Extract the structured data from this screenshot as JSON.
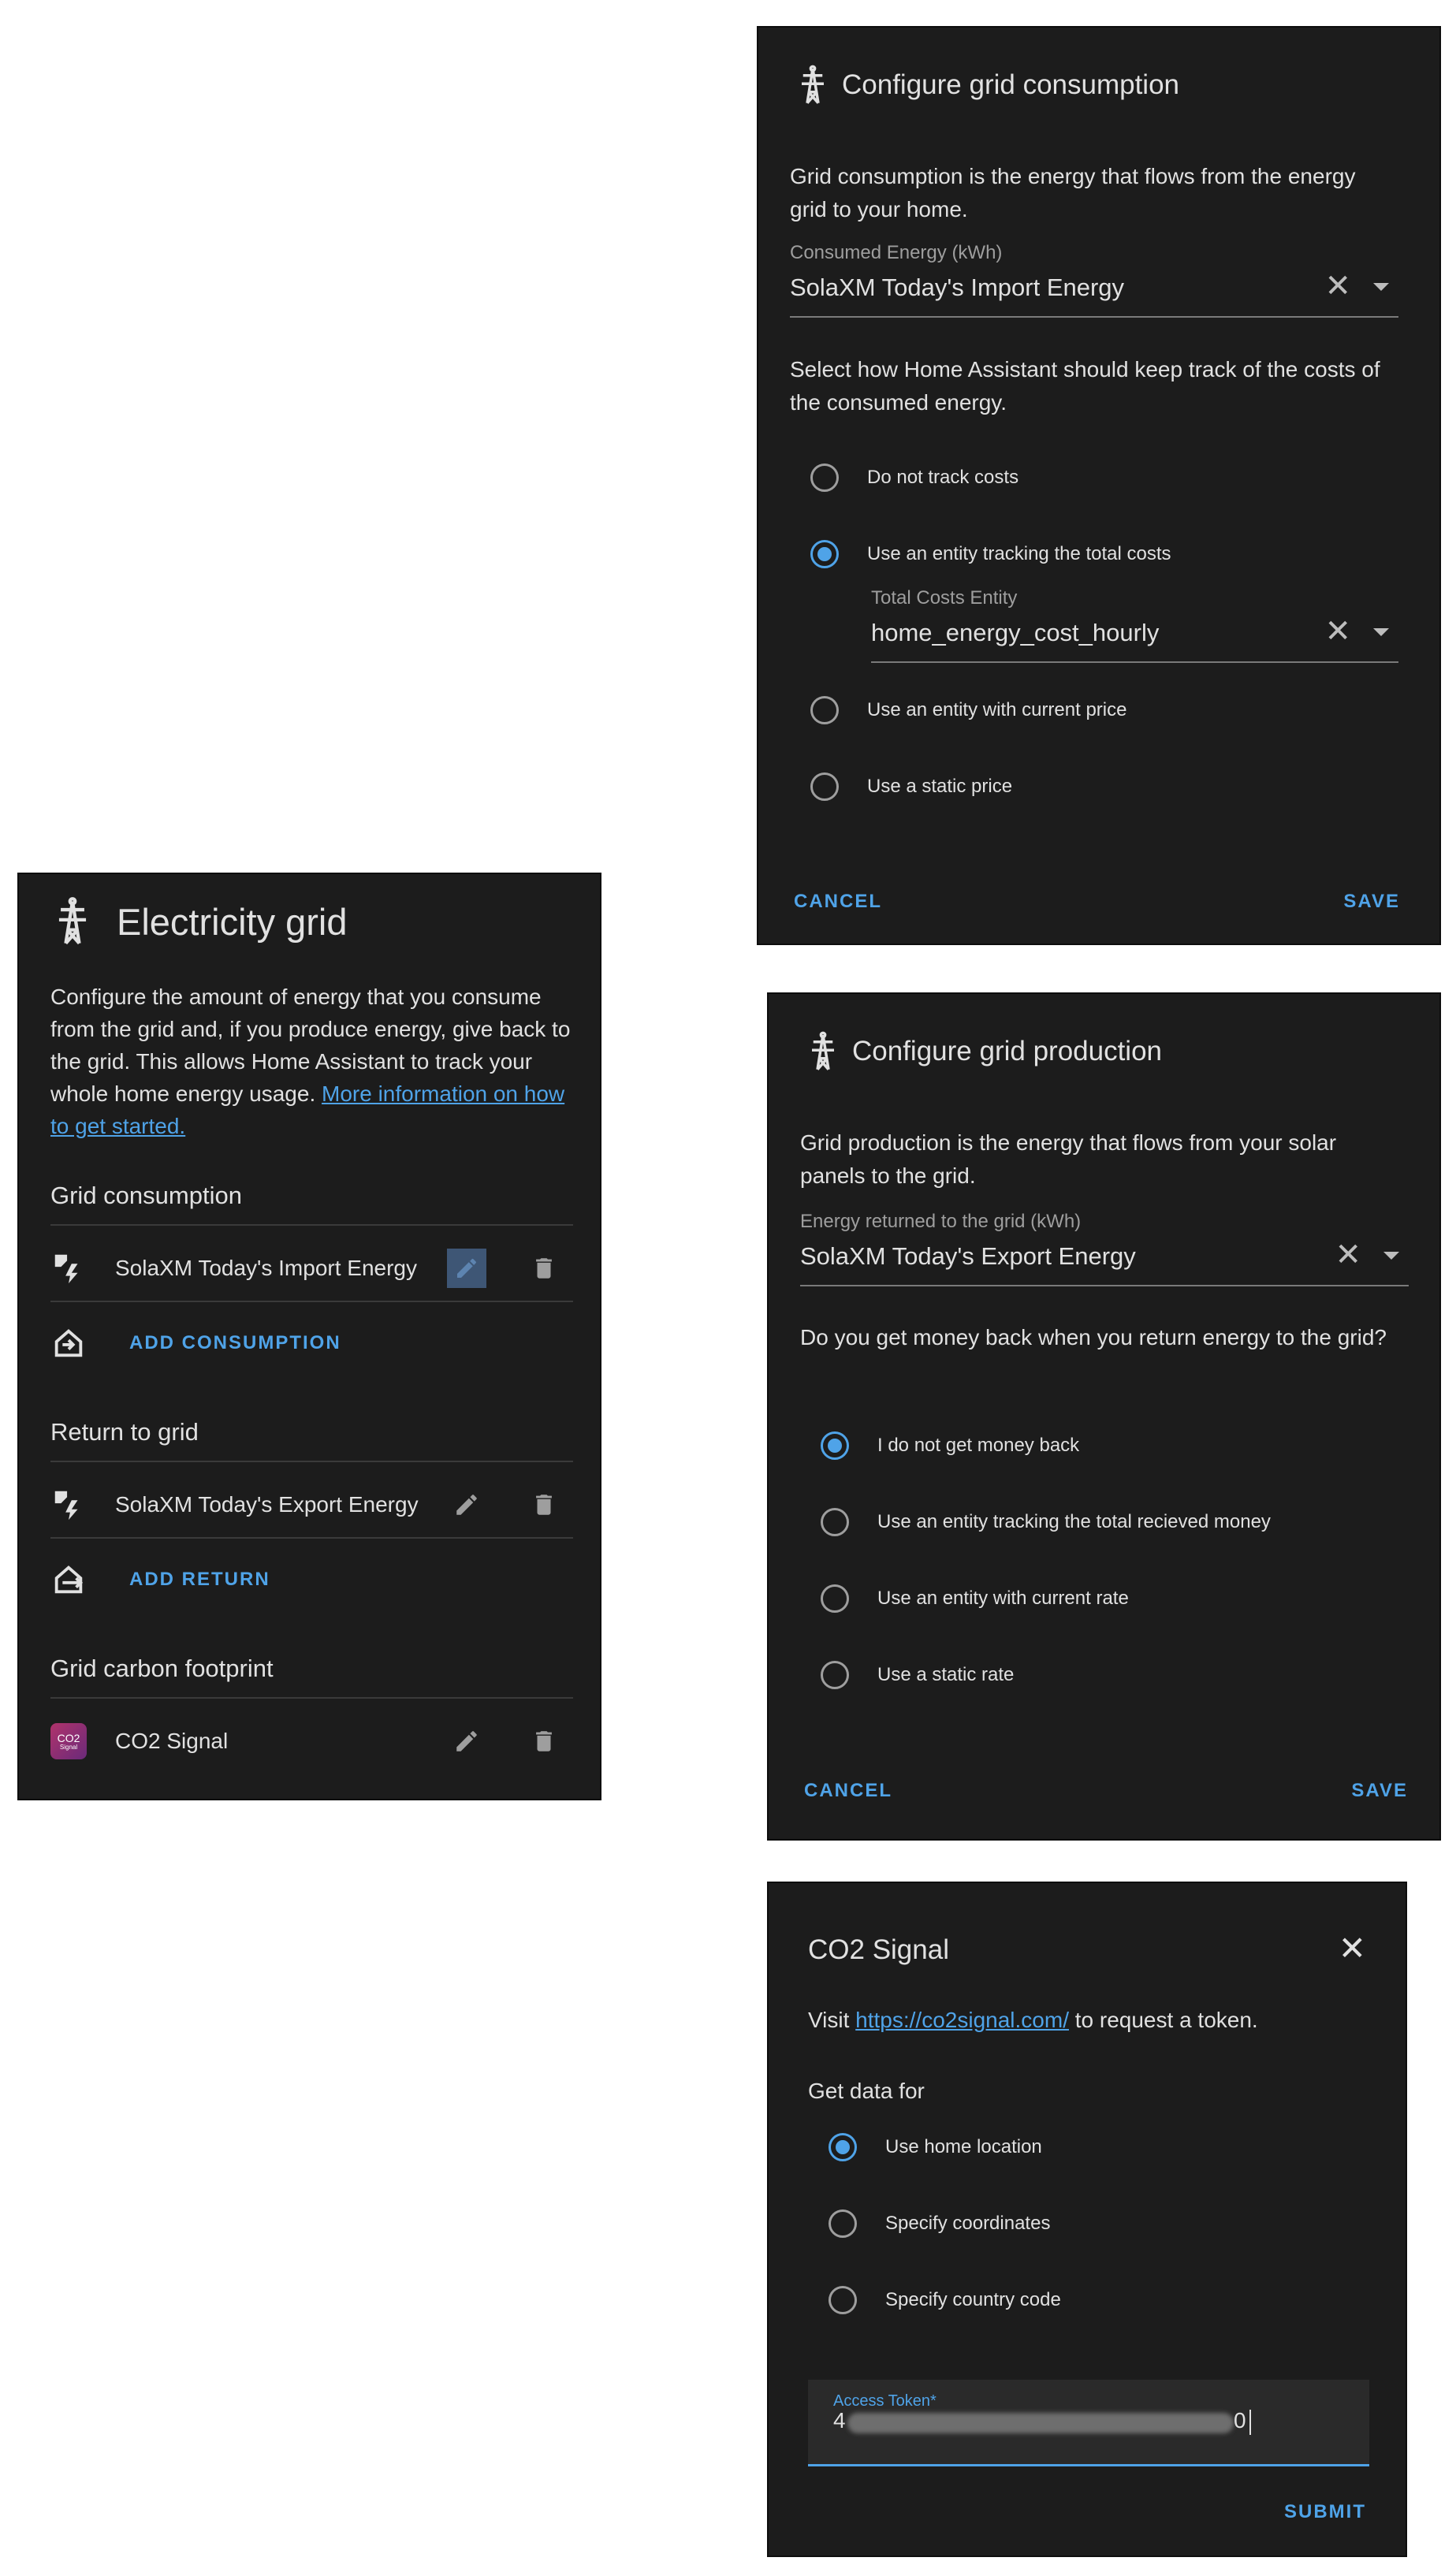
{
  "grid_panel": {
    "title": "Electricity grid",
    "description": "Configure the amount of energy that you consume from the grid and, if you produce energy, give back to the grid. This allows Home Assistant to track your whole home energy usage.",
    "more_info_link": "More information on how to get started.",
    "consumption": {
      "header": "Grid consumption",
      "entity": "SolaXM Today's Import Energy",
      "add_label": "ADD CONSUMPTION"
    },
    "return": {
      "header": "Return to grid",
      "entity": "SolaXM Today's Export Energy",
      "add_label": "ADD RETURN"
    },
    "carbon": {
      "header": "Grid carbon footprint",
      "entity": "CO2 Signal",
      "logo_text": "CO2",
      "logo_sub": "Signal"
    }
  },
  "consumption_dialog": {
    "title": "Configure grid consumption",
    "description": "Grid consumption is the energy that flows from the energy grid to your home.",
    "field_label": "Consumed Energy (kWh)",
    "field_value": "SolaXM Today's Import Energy",
    "cost_prompt": "Select how Home Assistant should keep track of the costs of the consumed energy.",
    "options": [
      {
        "label": "Do not track costs",
        "selected": false
      },
      {
        "label": "Use an entity tracking the total costs",
        "selected": true
      },
      {
        "label": "Use an entity with current price",
        "selected": false
      },
      {
        "label": "Use a static price",
        "selected": false
      }
    ],
    "cost_entity_label": "Total Costs Entity",
    "cost_entity_value": "home_energy_cost_hourly",
    "cancel": "CANCEL",
    "save": "SAVE"
  },
  "production_dialog": {
    "title": "Configure grid production",
    "description": "Grid production is the energy that flows from your solar panels to the grid.",
    "field_label": "Energy returned to the grid (kWh)",
    "field_value": "SolaXM Today's Export Energy",
    "money_prompt": "Do you get money back when you return energy to the grid?",
    "options": [
      {
        "label": "I do not get money back",
        "selected": true
      },
      {
        "label": "Use an entity tracking the total recieved money",
        "selected": false
      },
      {
        "label": "Use an entity with current rate",
        "selected": false
      },
      {
        "label": "Use a static rate",
        "selected": false
      }
    ],
    "cancel": "CANCEL",
    "save": "SAVE"
  },
  "co2_dialog": {
    "title": "CO2 Signal",
    "visit_prefix": "Visit ",
    "visit_link": "https://co2signal.com/",
    "visit_suffix": " to request a token.",
    "get_data_for": "Get data for",
    "options": [
      {
        "label": "Use home location",
        "selected": true
      },
      {
        "label": "Specify coordinates",
        "selected": false
      },
      {
        "label": "Specify country code",
        "selected": false
      }
    ],
    "token_label": "Access Token*",
    "token_value_start": "4",
    "token_value_end": "0",
    "submit": "SUBMIT"
  },
  "colors": {
    "accent": "#4fa3e8",
    "surface": "#1c1c1c",
    "text": "#e1e1e1",
    "muted": "#9e9e9e"
  }
}
